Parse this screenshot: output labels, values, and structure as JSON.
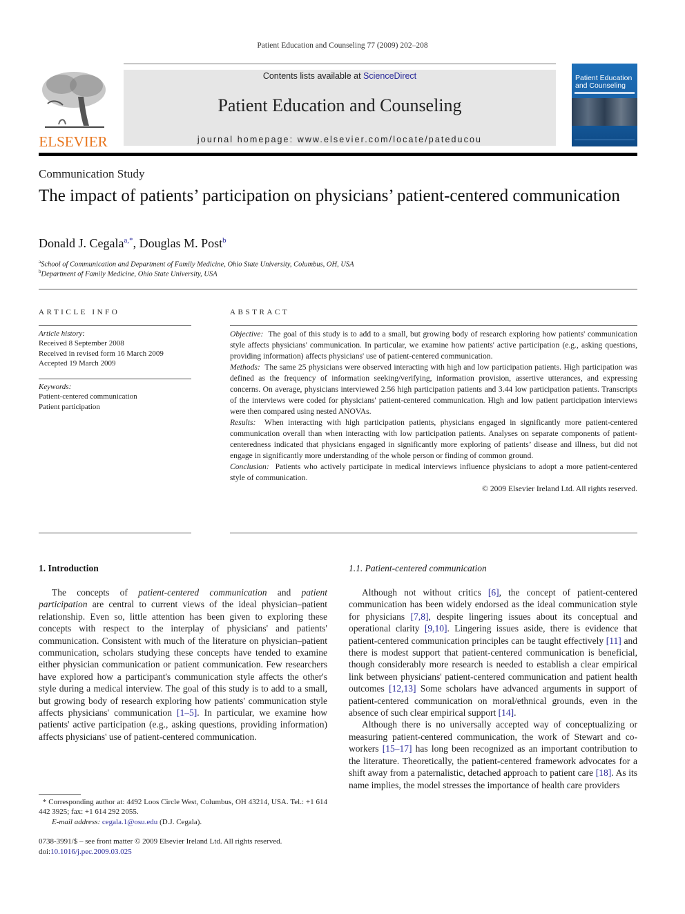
{
  "running_head": "Patient Education and Counseling 77 (2009) 202–208",
  "publisher": {
    "logo_word": "ELSEVIER",
    "logo_color": "#e8761e"
  },
  "banner": {
    "contents_prefix": "Contents lists available at ",
    "contents_link": "ScienceDirect",
    "journal_title": "Patient Education and Counseling",
    "homepage": "journal homepage: www.elsevier.com/locate/pateducou"
  },
  "cover": {
    "title_line1": "Patient Education",
    "title_line2": "and Counseling",
    "color": "#1d6fb8"
  },
  "article": {
    "section": "Communication Study",
    "title": "The impact of patients’ participation on physicians’ patient-centered communication",
    "authors": [
      {
        "name": "Donald J. Cegala",
        "sup": "a,*"
      },
      {
        "name": "Douglas M. Post",
        "sup": "b"
      }
    ],
    "affiliations": [
      {
        "sup": "a",
        "text": "School of Communication and Department of Family Medicine, Ohio State University, Columbus, OH, USA"
      },
      {
        "sup": "b",
        "text": "Department of Family Medicine, Ohio State University, USA"
      }
    ]
  },
  "article_info": {
    "heading": "ARTICLE INFO",
    "history_label": "Article history:",
    "history": [
      "Received 8 September 2008",
      "Received in revised form 16 March 2009",
      "Accepted 19 March 2009"
    ],
    "keywords_label": "Keywords:",
    "keywords": [
      "Patient-centered communication",
      "Patient participation"
    ]
  },
  "abstract": {
    "heading": "ABSTRACT",
    "sections": [
      {
        "label": "Objective:",
        "text": "The goal of this study is to add to a small, but growing body of research exploring how patients' communication style affects physicians' communication. In particular, we examine how patients' active participation (e.g., asking questions, providing information) affects physicians' use of patient-centered communication."
      },
      {
        "label": "Methods:",
        "text": "The same 25 physicians were observed interacting with high and low participation patients. High participation was defined as the frequency of information seeking/verifying, information provision, assertive utterances, and expressing concerns. On average, physicians interviewed 2.56 high participation patients and 3.44 low participation patients. Transcripts of the interviews were coded for physicians' patient-centered communication. High and low patient participation interviews were then compared using nested ANOVAs."
      },
      {
        "label": "Results:",
        "text": "When interacting with high participation patients, physicians engaged in significantly more patient-centered communication overall than when interacting with low participation patients. Analyses on separate components of patient-centeredness indicated that physicians engaged in significantly more exploring of patients’ disease and illness, but did not engage in significantly more understanding of the whole person or finding of common ground."
      },
      {
        "label": "Conclusion:",
        "text": "Patients who actively participate in medical interviews influence physicians to adopt a more patient-centered style of communication."
      }
    ],
    "copyright": "© 2009 Elsevier Ireland Ltd. All rights reserved."
  },
  "introduction": {
    "heading": "1.  Introduction",
    "p1": {
      "t1": "The concepts of ",
      "i1": "patient-centered communication",
      "t2": " and ",
      "i2": "patient participation",
      "t3": " are central to current views of the ideal physician–patient relationship. Even so, little attention has been given to exploring these concepts with respect to the interplay of physicians' and patients' communication. Consistent with much of the literature on physician–patient communication, scholars studying these concepts have tended to examine either physician communication or patient communication. Few researchers have explored how a participant's communication style affects the other's style during a medical interview. The goal of this study is to add to a small, but growing body of research exploring how patients' communication style affects physicians' communication ",
      "ref1": "[1–5]",
      "t4": ". In particular, we examine how patients' active participation (e.g., asking questions, providing information) affects physicians' use of patient-centered communication."
    }
  },
  "subsection": {
    "heading": "1.1.  Patient-centered communication",
    "p1": {
      "t1": "Although not without critics ",
      "r1": "[6]",
      "t2": ", the concept of patient-centered communication has been widely endorsed as the ideal communication style for physicians ",
      "r2": "[7,8]",
      "t3": ", despite lingering issues about its conceptual and operational clarity ",
      "r3": "[9,10]",
      "t4": ". Lingering issues aside, there is evidence that patient-centered communication principles can be taught effectively ",
      "r4": "[11]",
      "t5": " and there is modest support that patient-centered communication is beneficial, though considerably more research is needed to establish a clear empirical link between physicians' patient-centered communication and patient health outcomes ",
      "r5": "[12,13]",
      "t6": " Some scholars have advanced arguments in support of patient-centered communication on moral/ethnical grounds, even in the absence of such clear empirical support ",
      "r6": "[14]",
      "t7": "."
    },
    "p2": {
      "t1": "Although there is no universally accepted way of conceptualizing or measuring patient-centered communication, the work of Stewart and co-workers ",
      "r1": "[15–17]",
      "t2": " has long been recognized as an important contribution to the literature. Theoretically, the patient-centered framework advocates for a shift away from a paternalistic, detached approach to patient care ",
      "r2": "[18]",
      "t3": ". As its name implies, the model stresses the importance of health care providers"
    }
  },
  "footnote": {
    "marker": "*",
    "text": " Corresponding author at: 4492 Loos Circle West, Columbus, OH 43214, USA. Tel.: +1 614 442 3925; fax: +1 614 292 2055.",
    "email_label": "E-mail address:",
    "email": "cegala.1@osu.edu",
    "email_suffix": " (D.J. Cegala)."
  },
  "front_matter": {
    "issn_line": "0738-3991/$ – see front matter © 2009 Elsevier Ireland Ltd. All rights reserved.",
    "doi_prefix": "doi:",
    "doi": "10.1016/j.pec.2009.03.025"
  }
}
